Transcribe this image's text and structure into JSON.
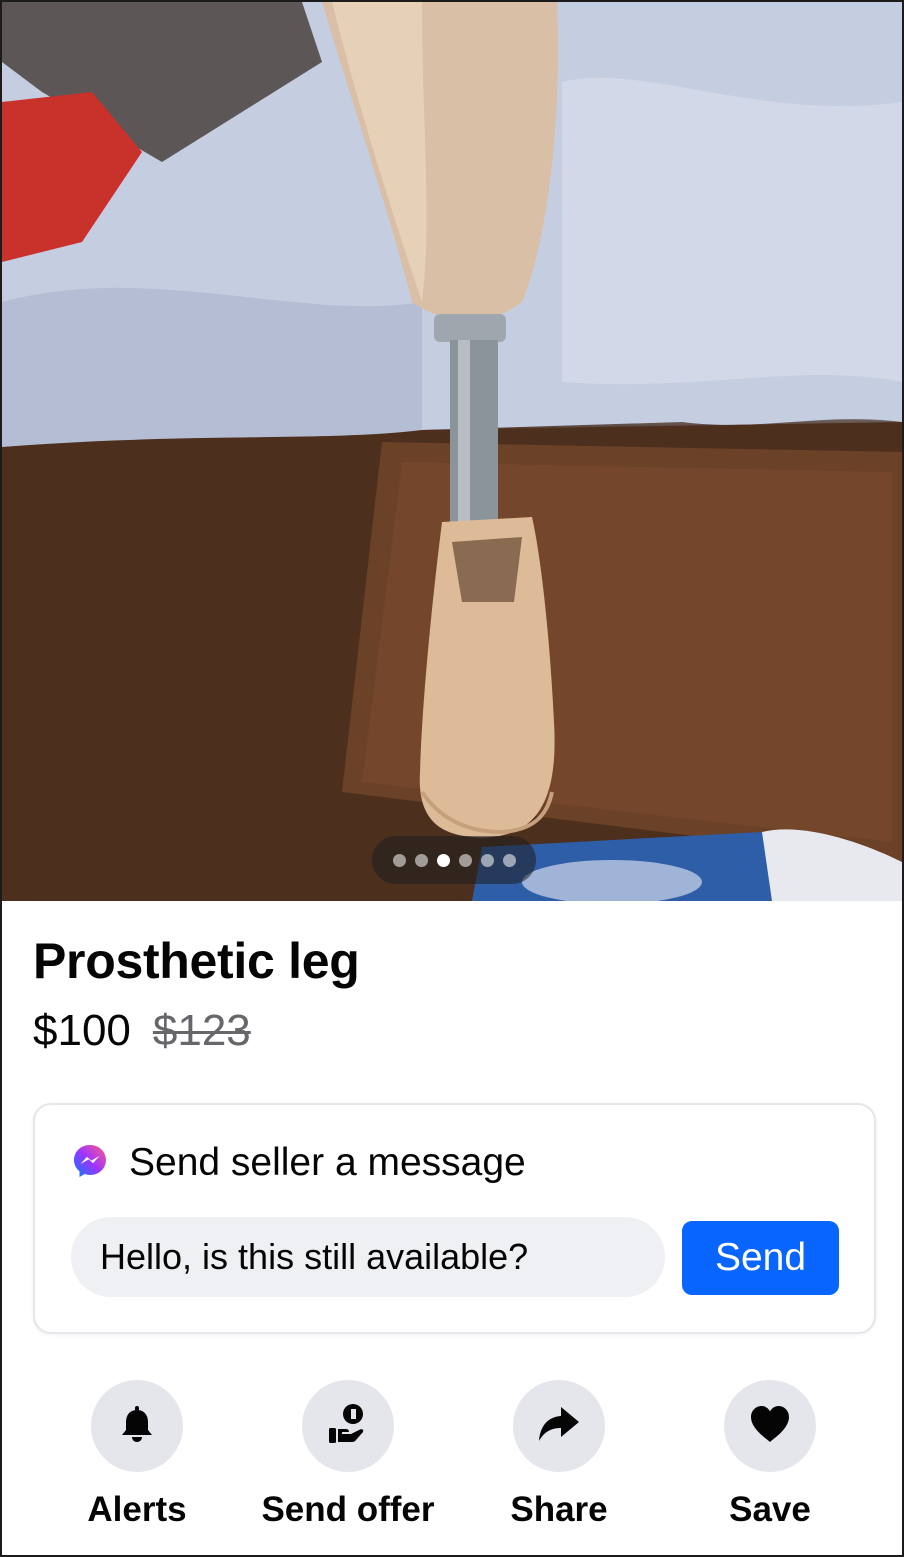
{
  "listing": {
    "title": "Prosthetic leg",
    "price": "$100",
    "original_price": "$123",
    "photo_count": 6,
    "active_photo_index": 2
  },
  "message": {
    "heading": "Send seller a message",
    "input_value": "Hello, is this still available?",
    "send_label": "Send"
  },
  "actions": [
    {
      "label": "Alerts",
      "icon": "bell-icon"
    },
    {
      "label": "Send offer",
      "icon": "offer-hand-icon"
    },
    {
      "label": "Share",
      "icon": "share-arrow-icon"
    },
    {
      "label": "Save",
      "icon": "heart-icon"
    }
  ],
  "colors": {
    "accent": "#0866ff",
    "action_circle": "#e4e6eb",
    "input_bg": "#eff0f3",
    "muted_text": "#65676b"
  }
}
